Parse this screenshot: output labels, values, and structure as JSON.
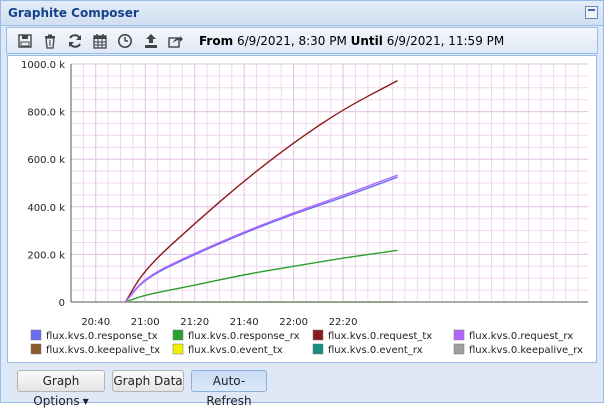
{
  "window": {
    "title": "Graphite Composer"
  },
  "toolbar": {
    "icons": [
      "save-icon",
      "trash-icon",
      "refresh-icon",
      "calendar-icon",
      "clock-icon",
      "upload-icon",
      "share-icon"
    ],
    "from_label": "From",
    "from_value": "6/9/2021, 8:30 PM",
    "until_label": "Until",
    "until_value": "6/9/2021, 11:59 PM"
  },
  "buttons": {
    "graph_options": "Graph Options",
    "graph_data": "Graph Data",
    "auto_refresh": "Auto-Refresh"
  },
  "chart_data": {
    "type": "line",
    "x_ticks": [
      "20:40",
      "21:00",
      "21:20",
      "21:40",
      "22:00",
      "22:20"
    ],
    "y_ticks": [
      "0",
      "200.0 k",
      "400.0 k",
      "600.0 k",
      "800.0 k",
      "1000.0 k"
    ],
    "ylim": [
      0,
      1000000
    ],
    "xlim": [
      "20:30",
      "23:59"
    ],
    "grid": true,
    "legend_position": "bottom",
    "series": [
      {
        "name": "flux.kvs.0.response_tx",
        "color": "#6b6bf0",
        "points": [
          [
            "20:52",
            0
          ],
          [
            "21:00",
            100000
          ],
          [
            "21:20",
            200000
          ],
          [
            "21:40",
            290000
          ],
          [
            "22:00",
            370000
          ],
          [
            "22:20",
            440000
          ],
          [
            "22:42",
            525000
          ]
        ]
      },
      {
        "name": "flux.kvs.0.response_rx",
        "color": "#2ca02c",
        "points": [
          [
            "20:52",
            0
          ],
          [
            "21:00",
            30000
          ],
          [
            "21:20",
            70000
          ],
          [
            "21:40",
            115000
          ],
          [
            "22:00",
            150000
          ],
          [
            "22:20",
            185000
          ],
          [
            "22:42",
            217000
          ]
        ]
      },
      {
        "name": "flux.kvs.0.request_tx",
        "color": "#8b1a1a",
        "points": [
          [
            "20:52",
            0
          ],
          [
            "21:00",
            140000
          ],
          [
            "21:20",
            330000
          ],
          [
            "21:40",
            510000
          ],
          [
            "22:00",
            670000
          ],
          [
            "22:20",
            810000
          ],
          [
            "22:42",
            930000
          ]
        ]
      },
      {
        "name": "flux.kvs.0.request_rx",
        "color": "#b266ff",
        "points": [
          [
            "20:52",
            0
          ],
          [
            "21:00",
            105000
          ],
          [
            "21:20",
            205000
          ],
          [
            "21:40",
            295000
          ],
          [
            "22:00",
            375000
          ],
          [
            "22:20",
            448000
          ],
          [
            "22:42",
            533000
          ]
        ]
      },
      {
        "name": "flux.kvs.0.keepalive_tx",
        "color": "#8b5a2b",
        "points": [
          [
            "20:52",
            0
          ],
          [
            "22:42",
            0
          ]
        ]
      },
      {
        "name": "flux.kvs.0.event_tx",
        "color": "#f0f000",
        "points": [
          [
            "20:52",
            0
          ],
          [
            "22:42",
            0
          ]
        ]
      },
      {
        "name": "flux.kvs.0.event_rx",
        "color": "#1a8c80",
        "points": [
          [
            "20:52",
            0
          ],
          [
            "22:42",
            0
          ]
        ]
      },
      {
        "name": "flux.kvs.0.keepalive_rx",
        "color": "#a0a0a0",
        "points": [
          [
            "20:52",
            0
          ],
          [
            "22:42",
            0
          ]
        ]
      }
    ]
  }
}
